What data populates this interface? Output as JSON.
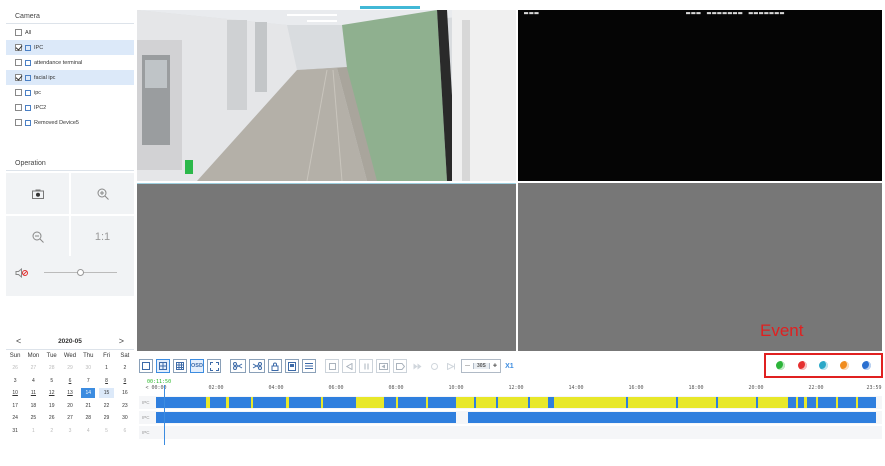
{
  "camera_panel": {
    "title": "Camera",
    "items": [
      {
        "label": "All",
        "checked": false,
        "selected": false,
        "device_icon": false
      },
      {
        "label": "IPC",
        "checked": true,
        "selected": true,
        "device_icon": true
      },
      {
        "label": "attendance terminal",
        "checked": false,
        "selected": false,
        "device_icon": true
      },
      {
        "label": "facial ipc",
        "checked": true,
        "selected": true,
        "device_icon": true
      },
      {
        "label": "ipc",
        "checked": false,
        "selected": false,
        "device_icon": true
      },
      {
        "label": "IPC2",
        "checked": false,
        "selected": false,
        "device_icon": true
      },
      {
        "label": "Removed Device5",
        "checked": false,
        "selected": false,
        "device_icon": true
      }
    ]
  },
  "operation_panel": {
    "title": "Operation",
    "buttons": [
      {
        "icon": "snapshot-icon"
      },
      {
        "icon": "zoom-in-icon"
      },
      {
        "icon": "zoom-out-icon"
      },
      {
        "icon": "original-size-icon",
        "label": "1:1"
      }
    ],
    "volume_icon": "volume-muted-icon",
    "volume_level": 0.5
  },
  "calendar": {
    "title": "2020-05",
    "prev_label": "<",
    "next_label": ">",
    "weekdays": [
      "Sun",
      "Mon",
      "Tue",
      "Wed",
      "Thu",
      "Fri",
      "Sat"
    ],
    "days": [
      {
        "d": "26",
        "m": "prev"
      },
      {
        "d": "27",
        "m": "prev"
      },
      {
        "d": "28",
        "m": "prev"
      },
      {
        "d": "29",
        "m": "prev"
      },
      {
        "d": "30",
        "m": "prev"
      },
      {
        "d": "1",
        "m": "cur"
      },
      {
        "d": "2",
        "m": "cur"
      },
      {
        "d": "3",
        "m": "cur"
      },
      {
        "d": "4",
        "m": "cur"
      },
      {
        "d": "5",
        "m": "cur"
      },
      {
        "d": "6",
        "m": "rec"
      },
      {
        "d": "7",
        "m": "cur"
      },
      {
        "d": "8",
        "m": "rec"
      },
      {
        "d": "9",
        "m": "rec"
      },
      {
        "d": "10",
        "m": "rec"
      },
      {
        "d": "11",
        "m": "rec"
      },
      {
        "d": "12",
        "m": "rec"
      },
      {
        "d": "13",
        "m": "rec"
      },
      {
        "d": "14",
        "m": "today"
      },
      {
        "d": "15",
        "m": "hl"
      },
      {
        "d": "16",
        "m": "cur"
      },
      {
        "d": "17",
        "m": "cur"
      },
      {
        "d": "18",
        "m": "cur"
      },
      {
        "d": "19",
        "m": "cur"
      },
      {
        "d": "20",
        "m": "cur"
      },
      {
        "d": "21",
        "m": "cur"
      },
      {
        "d": "22",
        "m": "cur"
      },
      {
        "d": "23",
        "m": "cur"
      },
      {
        "d": "24",
        "m": "cur"
      },
      {
        "d": "25",
        "m": "cur"
      },
      {
        "d": "26",
        "m": "cur"
      },
      {
        "d": "27",
        "m": "cur"
      },
      {
        "d": "28",
        "m": "cur"
      },
      {
        "d": "29",
        "m": "cur"
      },
      {
        "d": "30",
        "m": "cur"
      },
      {
        "d": "31",
        "m": "cur"
      },
      {
        "d": "1",
        "m": "next"
      },
      {
        "d": "2",
        "m": "next"
      },
      {
        "d": "3",
        "m": "next"
      },
      {
        "d": "4",
        "m": "next"
      },
      {
        "d": "5",
        "m": "next"
      },
      {
        "d": "6",
        "m": "next"
      }
    ]
  },
  "toolbar": {
    "osd_label": "OSD",
    "speed_box": {
      "minus": "—",
      "value": "30S",
      "plus": "✚"
    },
    "speed_label": "X1",
    "event_label": "Event",
    "event_buttons": [
      {
        "icon": "event-motion-icon",
        "color": "#2db43a"
      },
      {
        "icon": "event-alarm-icon",
        "color": "#e53030"
      },
      {
        "icon": "event-intelligent-icon",
        "color": "#2aa8c8"
      },
      {
        "icon": "event-pos-icon",
        "color": "#f08c1e"
      },
      {
        "icon": "event-manual-icon",
        "color": "#2a6fd0"
      }
    ]
  },
  "timeline": {
    "current_time": "00:11:50",
    "ticks": [
      "< 00:00",
      "02:00",
      "04:00",
      "06:00",
      "08:00",
      "10:00",
      "12:00",
      "14:00",
      "16:00",
      "18:00",
      "20:00",
      "22:00",
      "23:59"
    ],
    "tracks": [
      {
        "label": "IPC",
        "type": "mixed"
      },
      {
        "label": "IPC",
        "type": "blue"
      },
      {
        "label": "IPC",
        "type": "empty"
      }
    ],
    "colors": {
      "normal": "#2f7fde",
      "event": "#e8e82a"
    }
  },
  "colors": {
    "accent": "#3c8ce0",
    "selection": "#dce9f9",
    "highlight_box": "#e02020"
  }
}
